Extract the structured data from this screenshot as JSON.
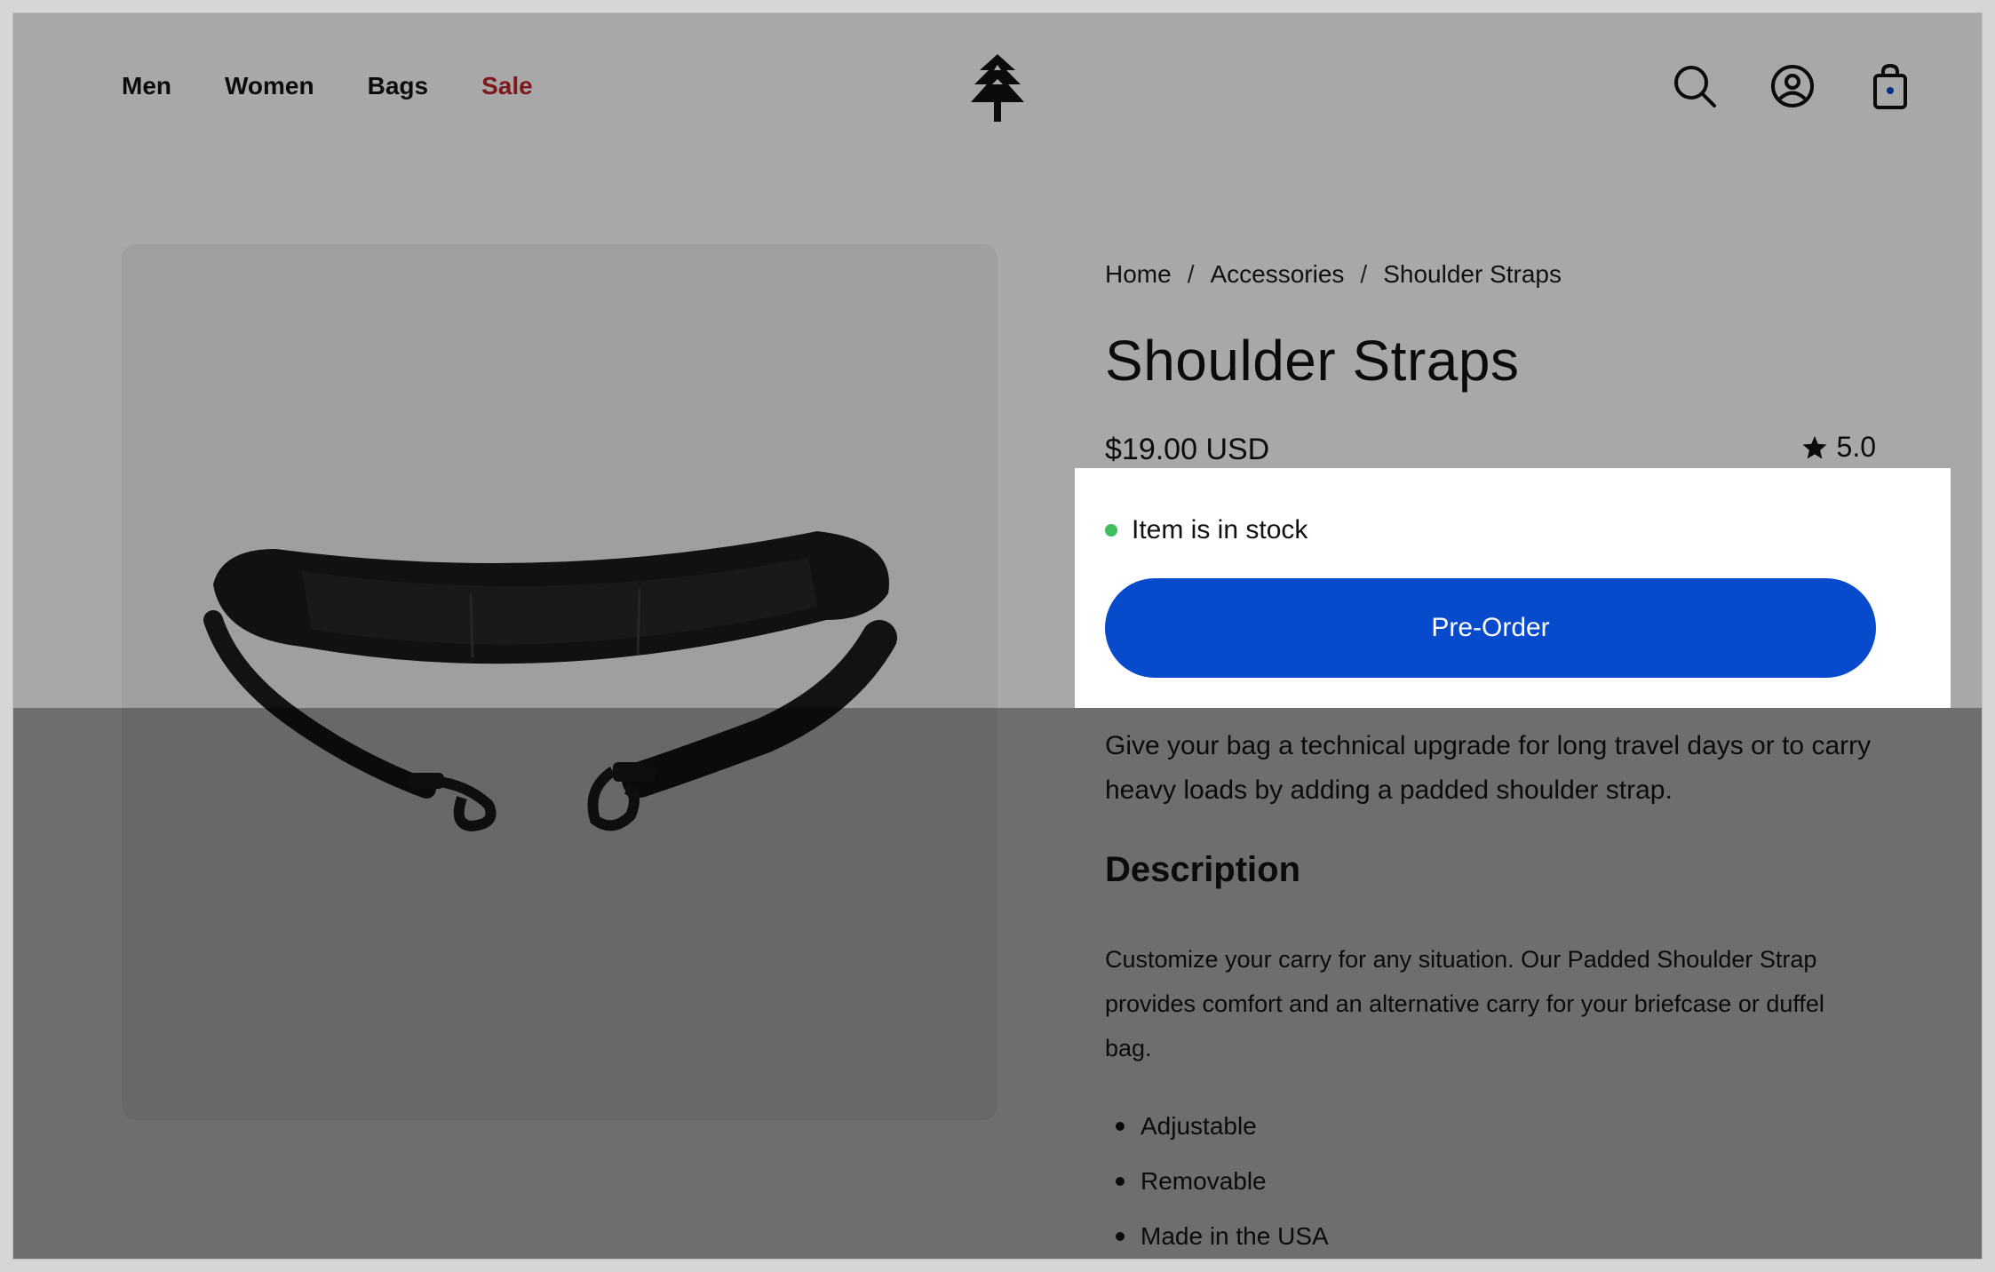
{
  "nav": {
    "items": [
      {
        "label": "Men"
      },
      {
        "label": "Women"
      },
      {
        "label": "Bags"
      },
      {
        "label": "Sale"
      }
    ]
  },
  "header": {
    "logo_icon": "tree-icon",
    "icons": [
      "search-icon",
      "account-icon",
      "cart-icon"
    ]
  },
  "breadcrumb": {
    "items": [
      "Home",
      "Accessories",
      "Shoulder Straps"
    ],
    "separator": "/"
  },
  "product": {
    "title": "Shoulder Straps",
    "price": "$19.00 USD",
    "rating": "5.0",
    "stock_status": "Item is in stock",
    "cta_label": "Pre-Order",
    "lead": "Give your bag a technical upgrade for long travel days or to carry heavy loads by adding a padded shoulder strap.",
    "description_heading": "Description",
    "description_body": "Customize your carry for any situation. Our Padded Shoulder Strap provides comfort and an alternative carry for your briefcase or duffel bag.",
    "features": [
      "Adjustable",
      "Removable",
      "Made in the USA"
    ]
  },
  "colors": {
    "cta": "#074bcc",
    "sale": "#c0262c",
    "stock_dot": "#3fbf5c"
  }
}
